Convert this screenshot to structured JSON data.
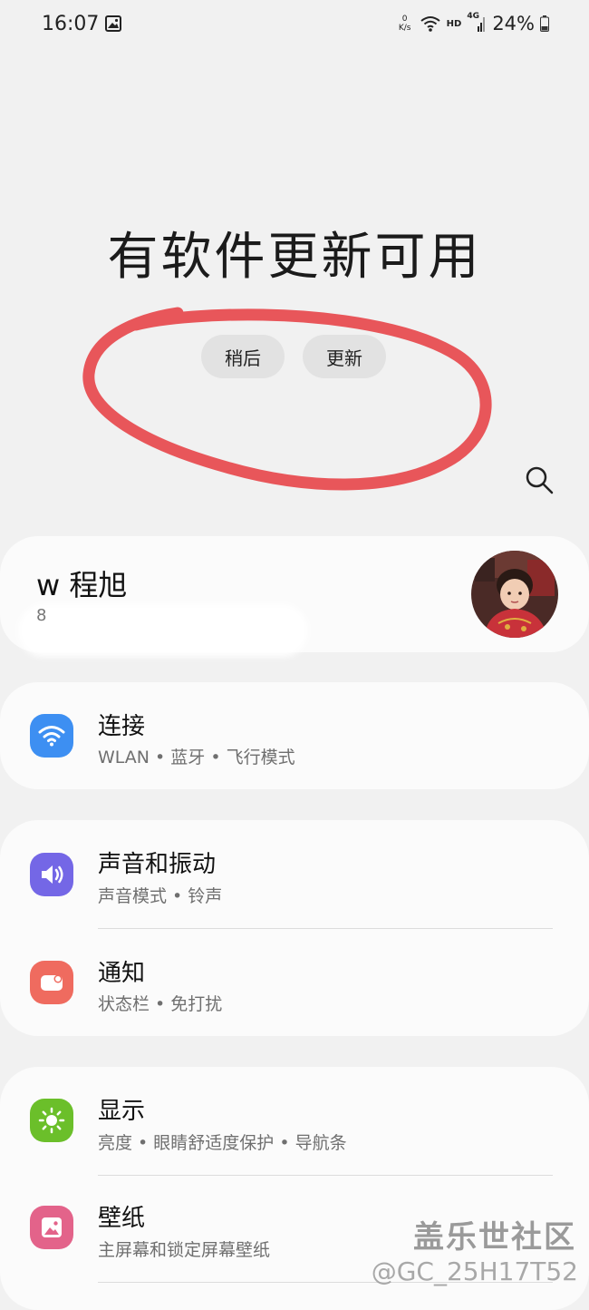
{
  "status_bar": {
    "time": "16:07",
    "net_speed_value": "0",
    "net_speed_unit": "K/s",
    "hd_label": "HD",
    "network_label": "4G",
    "battery": "24%"
  },
  "update_prompt": {
    "title": "有软件更新可用",
    "later_label": "稍后",
    "update_label": "更新",
    "circle_color": "#e8565a"
  },
  "profile": {
    "name": "w 程旭",
    "account_hint": "8"
  },
  "settings": {
    "connections": {
      "title": "连接",
      "subtitle": "WLAN • 蓝牙 • 飞行模式",
      "icon": "wifi-icon",
      "icon_color": "#3d8ff2"
    },
    "sound": {
      "title": "声音和振动",
      "subtitle": "声音模式 • 铃声",
      "icon": "speaker-icon",
      "icon_color": "#7467e6"
    },
    "notifications": {
      "title": "通知",
      "subtitle": "状态栏 • 免打扰",
      "icon": "notification-icon",
      "icon_color": "#ef6b5f"
    },
    "display": {
      "title": "显示",
      "subtitle": "亮度 • 眼睛舒适度保护 • 导航条",
      "icon": "sun-icon",
      "icon_color": "#6bbf2a"
    },
    "wallpaper": {
      "title": "壁纸",
      "subtitle": "主屏幕和锁定屏幕壁纸",
      "icon": "image-icon",
      "icon_color": "#e3638a"
    }
  },
  "watermark": {
    "title": "盖乐世社区",
    "user": "@GC_25H17T52"
  }
}
